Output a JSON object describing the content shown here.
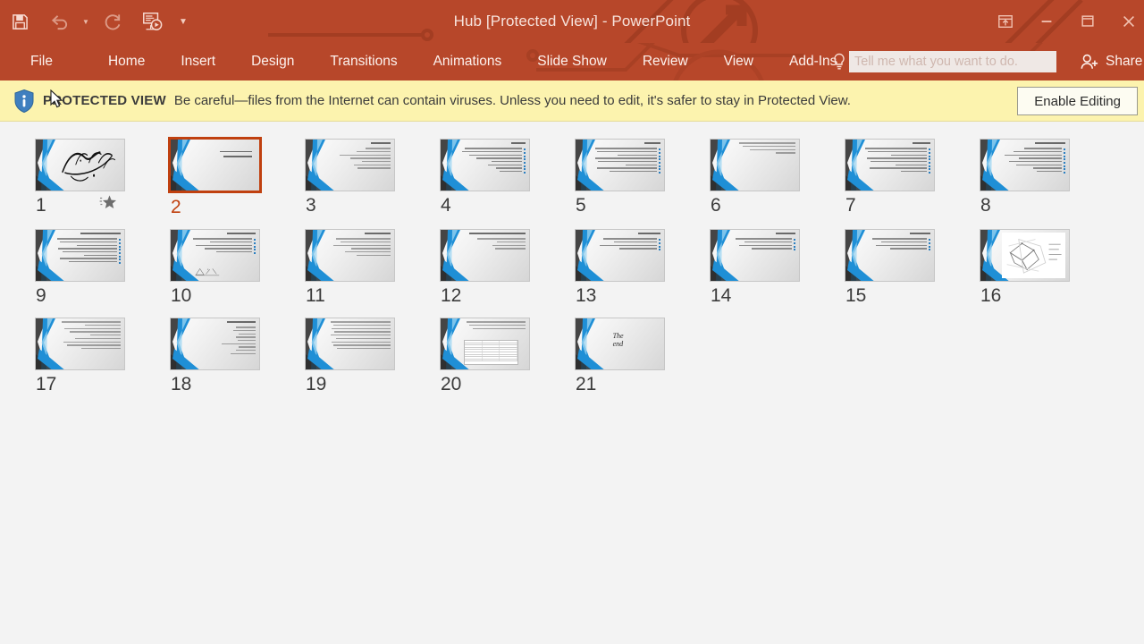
{
  "window": {
    "title": "Hub [Protected View] - PowerPoint",
    "accent_color": "#b7472a",
    "selected_border_color": "#c0400f"
  },
  "quick_access": {
    "items": [
      {
        "name": "save-icon",
        "label": "Save"
      },
      {
        "name": "undo-icon",
        "label": "Undo"
      },
      {
        "name": "redo-icon",
        "label": "Redo"
      },
      {
        "name": "start-from-beginning-icon",
        "label": "Start From Beginning"
      },
      {
        "name": "customize-quick-access-toolbar-icon",
        "label": "Customize Quick Access Toolbar"
      }
    ]
  },
  "window_controls": [
    {
      "name": "ribbon-display-options-button",
      "label": "Ribbon Display Options"
    },
    {
      "name": "minimize-button",
      "label": "Minimize"
    },
    {
      "name": "restore-button",
      "label": "Restore Down"
    },
    {
      "name": "close-button",
      "label": "Close"
    }
  ],
  "ribbon": {
    "tabs": [
      "File",
      "Home",
      "Insert",
      "Design",
      "Transitions",
      "Animations",
      "Slide Show",
      "Review",
      "View",
      "Add-Ins"
    ],
    "tell_me_placeholder": "Tell me what you want to do.",
    "share_label": "Share"
  },
  "protected_view": {
    "badge": "PROTECTED VIEW",
    "message": "Be careful—files from the Internet can contain viruses. Unless you need to edit, it's safer to stay in Protected View.",
    "button_label": "Enable Editing",
    "bar_color": "#fcf3ae"
  },
  "slides": [
    {
      "number": "1",
      "kind": "calligraphy",
      "selected": false,
      "has_animation": true,
      "lines": []
    },
    {
      "number": "2",
      "kind": "title-right",
      "selected": true,
      "has_animation": false,
      "lines": [
        70,
        62
      ]
    },
    {
      "number": "3",
      "kind": "content",
      "selected": false,
      "has_animation": false,
      "title": 30,
      "lines": [
        38,
        52,
        78,
        62,
        44,
        56,
        50
      ]
    },
    {
      "number": "4",
      "kind": "bullets",
      "selected": false,
      "has_animation": false,
      "title": 22,
      "lines": [
        88,
        92,
        80,
        70,
        46,
        52,
        40,
        34
      ]
    },
    {
      "number": "5",
      "kind": "bullets",
      "selected": false,
      "has_animation": false,
      "title": 24,
      "lines": [
        96,
        92,
        60,
        94,
        90,
        48,
        92,
        72
      ]
    },
    {
      "number": "6",
      "kind": "content",
      "selected": false,
      "has_animation": false,
      "title": 0,
      "lines": [
        86,
        80,
        70,
        30
      ]
    },
    {
      "number": "7",
      "kind": "bullets",
      "selected": false,
      "has_animation": false,
      "title": 28,
      "lines": [
        94,
        90,
        54,
        92,
        86,
        48,
        88,
        40
      ]
    },
    {
      "number": "8",
      "kind": "bullets",
      "selected": false,
      "has_animation": false,
      "title": 46,
      "lines": [
        58,
        74,
        88,
        66,
        80,
        70,
        44,
        38
      ]
    },
    {
      "number": "9",
      "kind": "bullets",
      "selected": false,
      "has_animation": false,
      "title": 62,
      "lines": [
        92,
        88,
        62,
        90,
        84,
        50,
        88,
        74
      ]
    },
    {
      "number": "10",
      "kind": "figure-bl",
      "selected": false,
      "has_animation": false,
      "title": 44,
      "lines": [
        90,
        64,
        86,
        72,
        54
      ]
    },
    {
      "number": "11",
      "kind": "content",
      "selected": false,
      "has_animation": false,
      "title": 40,
      "lines": [
        84,
        76,
        88,
        60,
        70,
        52
      ]
    },
    {
      "number": "12",
      "kind": "title-wrap",
      "selected": false,
      "has_animation": false,
      "title": 86,
      "lines": [
        74,
        44,
        50,
        46
      ]
    },
    {
      "number": "13",
      "kind": "latin",
      "selected": false,
      "has_animation": false,
      "title": 34,
      "lines": [
        82,
        66,
        88,
        58
      ]
    },
    {
      "number": "14",
      "kind": "latin",
      "selected": false,
      "has_animation": false,
      "title": 30,
      "lines": [
        86,
        72,
        80,
        62
      ]
    },
    {
      "number": "15",
      "kind": "latin",
      "selected": false,
      "has_animation": false,
      "title": 32,
      "lines": [
        84,
        70,
        78,
        56
      ]
    },
    {
      "number": "16",
      "kind": "diagram",
      "selected": false,
      "has_animation": false,
      "lines": []
    },
    {
      "number": "17",
      "kind": "content",
      "selected": false,
      "has_animation": false,
      "title": 0,
      "lines": [
        90,
        54,
        86,
        78,
        46,
        70,
        88,
        82,
        60
      ]
    },
    {
      "number": "18",
      "kind": "list-center",
      "selected": false,
      "has_animation": false,
      "title": 44,
      "lines": [
        30,
        34,
        26,
        30,
        28,
        52,
        26,
        30,
        38
      ]
    },
    {
      "number": "19",
      "kind": "dense",
      "selected": false,
      "has_animation": false,
      "title": 0,
      "lines": [
        92,
        88,
        90,
        86,
        92,
        84,
        90,
        88,
        82
      ]
    },
    {
      "number": "20",
      "kind": "table",
      "selected": false,
      "has_animation": false,
      "title": 0,
      "lines": [
        90,
        86,
        80
      ]
    },
    {
      "number": "21",
      "kind": "theend",
      "selected": false,
      "has_animation": false,
      "text_line_1": "The",
      "text_line_2": "end"
    }
  ]
}
